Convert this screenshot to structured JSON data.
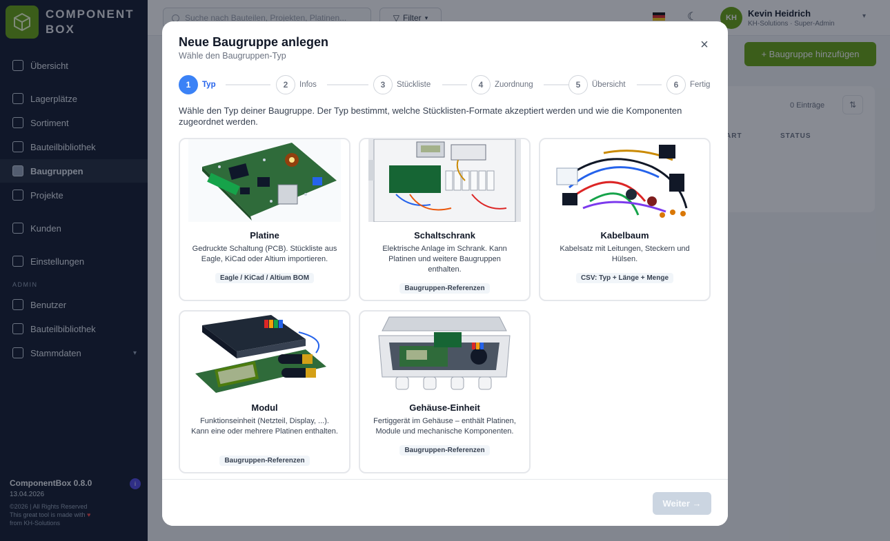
{
  "sidebar": {
    "brand_line1": "COMPONENT",
    "brand_line2": "BOX",
    "items": [
      {
        "label": "Übersicht"
      },
      {
        "label": "Lagerplätze"
      },
      {
        "label": "Sortiment"
      },
      {
        "label": "Bauteilbibliothek"
      },
      {
        "label": "Baugruppen"
      },
      {
        "label": "Projekte"
      },
      {
        "label": "Kunden"
      },
      {
        "label": "Einstellungen"
      }
    ],
    "admin_section": "ADMIN",
    "admin_items": [
      {
        "label": "Benutzer"
      },
      {
        "label": "Bauteilbibliothek"
      },
      {
        "label": "Stammdaten"
      }
    ],
    "version": "ComponentBox 0.8.0",
    "version_badge": "i",
    "date": "13.04.2026",
    "copyright_1": "©2026 | All Rights Reserved",
    "copyright_2": "This great tool is made with",
    "copyright_3": "from KH-Solutions"
  },
  "topbar": {
    "search_placeholder": "Suche nach Bauteilen, Projekten, Platinen...",
    "filter_label": "Filter",
    "user_initials": "KH",
    "user_name": "Kevin Heidrich",
    "user_role": "KH-Solutions · Super-Admin"
  },
  "background": {
    "add_button": "+ Baugruppe hinzufügen",
    "entries": "0 Einträge",
    "col_art": "ART",
    "col_status": "STATUS"
  },
  "modal": {
    "title": "Neue Baugruppe anlegen",
    "subtitle": "Wähle den Baugruppen-Typ",
    "close": "×",
    "steps": [
      {
        "num": "1",
        "label": "Typ"
      },
      {
        "num": "2",
        "label": "Infos"
      },
      {
        "num": "3",
        "label": "Stückliste"
      },
      {
        "num": "4",
        "label": "Zuordnung"
      },
      {
        "num": "5",
        "label": "Übersicht"
      },
      {
        "num": "6",
        "label": "Fertig"
      }
    ],
    "description": "Wähle den Typ deiner Baugruppe. Der Typ bestimmt, welche Stücklisten-Formate akzeptiert werden und wie die Komponenten zugeordnet werden.",
    "cards": [
      {
        "title": "Platine",
        "description": "Gedruckte Schaltung (PCB). Stückliste aus Eagle, KiCad oder Altium importieren.",
        "tag": "Eagle / KiCad / Altium BOM"
      },
      {
        "title": "Schaltschrank",
        "description": "Elektrische Anlage im Schrank. Kann Platinen und weitere Baugruppen enthalten.",
        "tag": "Baugruppen-Referenzen"
      },
      {
        "title": "Kabelbaum",
        "description": "Kabelsatz mit Leitungen, Steckern und Hülsen.",
        "tag": "CSV: Typ + Länge + Menge"
      },
      {
        "title": "Modul",
        "description": "Funktionseinheit (Netzteil, Display, ...). Kann eine oder mehrere Platinen enthalten.",
        "tag": "Baugruppen-Referenzen"
      },
      {
        "title": "Gehäuse-Einheit",
        "description": "Fertiggerät im Gehäuse – enthält Platinen, Module und mechanische Komponenten.",
        "tag": "Baugruppen-Referenzen"
      }
    ],
    "next_button": "Weiter →"
  },
  "colors": {
    "accent_blue": "#3b82f6",
    "brand_green": "#65a30d",
    "sidebar_bg": "#0f172a",
    "disabled_button": "#cbd5e1"
  }
}
